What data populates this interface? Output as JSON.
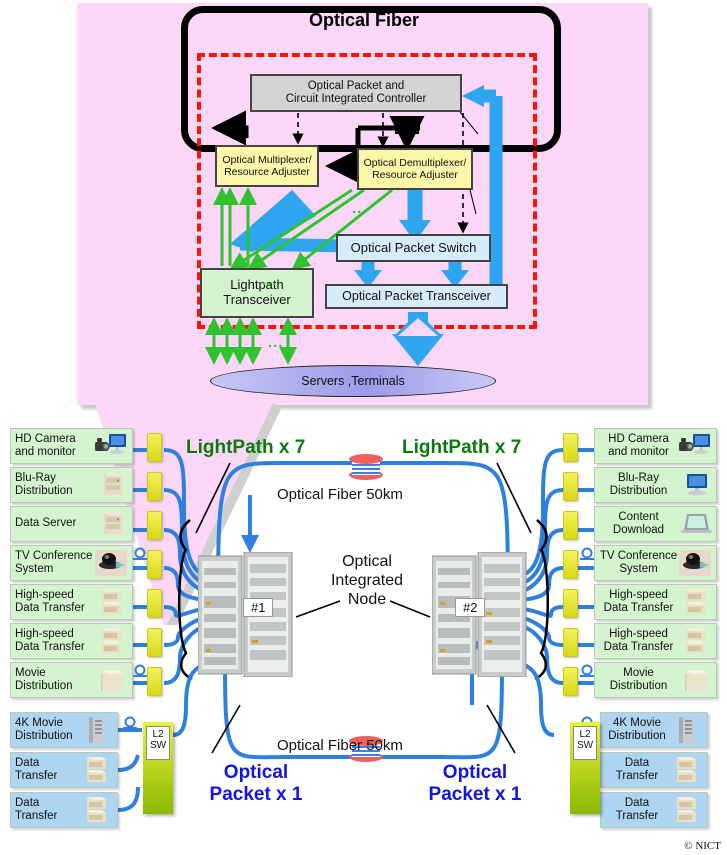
{
  "top_panel": {
    "fiber_ring_label": "Optical Fiber",
    "controller": "Optical Packet and\nCircuit Integrated Controller",
    "controller_line1": "Optical Packet and",
    "controller_line2": "Circuit Integrated Controller",
    "mux_line1": "Optical Multiplexer/",
    "mux_line2": "Resource Adjuster",
    "demux_line1": "Optical Demultiplexer/",
    "demux_line2": "Resource Adjuster",
    "optical_packet_switch": "Optical Packet Switch",
    "optical_packet_transceiver": "Optical Packet Transceiver",
    "lightpath_line1": "Lightpath",
    "lightpath_line2": "Transceiver",
    "servers_terminals": "Servers ,Terminals",
    "ellipsis": "..."
  },
  "center": {
    "lightpath_left": "LightPath x 7",
    "lightpath_right": "LightPath x 7",
    "optical_packet_left_l1": "Optical",
    "optical_packet_left_l2": "Packet  x 1",
    "optical_packet_right_l1": "Optical",
    "optical_packet_right_l2": "Packet  x 1",
    "fiber_top": "Optical Fiber 50km",
    "fiber_bottom": "Optical Fiber 50km",
    "node_l1": "Optical",
    "node_l2": "Integrated",
    "node_l3": "Node",
    "rack1": "#1",
    "rack2": "#2"
  },
  "left_endpoints": [
    {
      "l1": "HD Camera",
      "l2": "and monitor",
      "icon": "camera-monitor-icon",
      "color": "green",
      "optical": false
    },
    {
      "l1": "Blu-Ray",
      "l2": "Distribution",
      "icon": "server-icon",
      "color": "green",
      "optical": false
    },
    {
      "l1": "Data Server",
      "l2": "",
      "icon": "server-icon",
      "color": "green",
      "optical": false
    },
    {
      "l1": "TV Conference",
      "l2": "System",
      "icon": "webcam-icon",
      "color": "green",
      "optical": true
    },
    {
      "l1": "High-speed",
      "l2": "Data Transfer",
      "icon": "storage-icon",
      "color": "green",
      "optical": false
    },
    {
      "l1": "High-speed",
      "l2": "Data Transfer",
      "icon": "storage-icon",
      "color": "green",
      "optical": false
    },
    {
      "l1": "Movie",
      "l2": "Distribution",
      "icon": "box-server-icon",
      "color": "green",
      "optical": true
    }
  ],
  "left_packet_endpoints": [
    {
      "l1": "4K Movie",
      "l2": "Distribution",
      "icon": "tower-server-icon",
      "color": "blue",
      "optical": true
    },
    {
      "l1": "Data",
      "l2": "Transfer",
      "icon": "storage-icon",
      "color": "blue",
      "optical": false
    },
    {
      "l1": "Data",
      "l2": "Transfer",
      "icon": "storage-icon",
      "color": "blue",
      "optical": false
    }
  ],
  "right_endpoints": [
    {
      "l1": "HD Camera",
      "l2": "and monitor",
      "icon": "camera-monitor-icon",
      "color": "green",
      "optical": false
    },
    {
      "l1": "Blu-Ray",
      "l2": "Distribution",
      "icon": "monitor-icon",
      "color": "green",
      "optical": false
    },
    {
      "l1": "Content",
      "l2": "Download",
      "icon": "laptop-icon",
      "color": "green",
      "optical": false
    },
    {
      "l1": "TV Conference",
      "l2": "System",
      "icon": "webcam-icon",
      "color": "green",
      "optical": true
    },
    {
      "l1": "High-speed",
      "l2": "Data Transfer",
      "icon": "storage-icon",
      "color": "green",
      "optical": false
    },
    {
      "l1": "High-speed",
      "l2": "Data Transfer",
      "icon": "storage-icon",
      "color": "green",
      "optical": false
    },
    {
      "l1": "Movie",
      "l2": "Distribution",
      "icon": "box-server-icon",
      "color": "green",
      "optical": true
    }
  ],
  "right_packet_endpoints": [
    {
      "l1": "4K Movie",
      "l2": "Distribution",
      "icon": "tower-server-icon",
      "color": "blue",
      "optical": true
    },
    {
      "l1": "Data",
      "l2": "Transfer",
      "icon": "storage-icon",
      "color": "blue",
      "optical": false
    },
    {
      "l1": "Data",
      "l2": "Transfer",
      "icon": "storage-icon",
      "color": "blue",
      "optical": false
    }
  ],
  "l2sw": {
    "left_l1": "L2",
    "left_l2": "SW",
    "right_l1": "L2",
    "right_l2": "SW"
  },
  "copyright": "© NICT",
  "colors": {
    "panel_pink": "#fdd7f7",
    "dashed_red": "#ff1200",
    "yellow_box": "#fbf7a8",
    "blue_box": "#d6ecfa",
    "green_box": "#d4f3cf",
    "grey_box": "#d4d4d4",
    "arrow_blue": "#2da6ef",
    "arrow_green": "#2fc42f",
    "link_blue": "#2f7fe0",
    "lightpath_green": "#0a7a0a",
    "packet_blue": "#1414e0",
    "port_yellow": "#d8d818",
    "ellipse_purple": "#a8a8ee"
  }
}
